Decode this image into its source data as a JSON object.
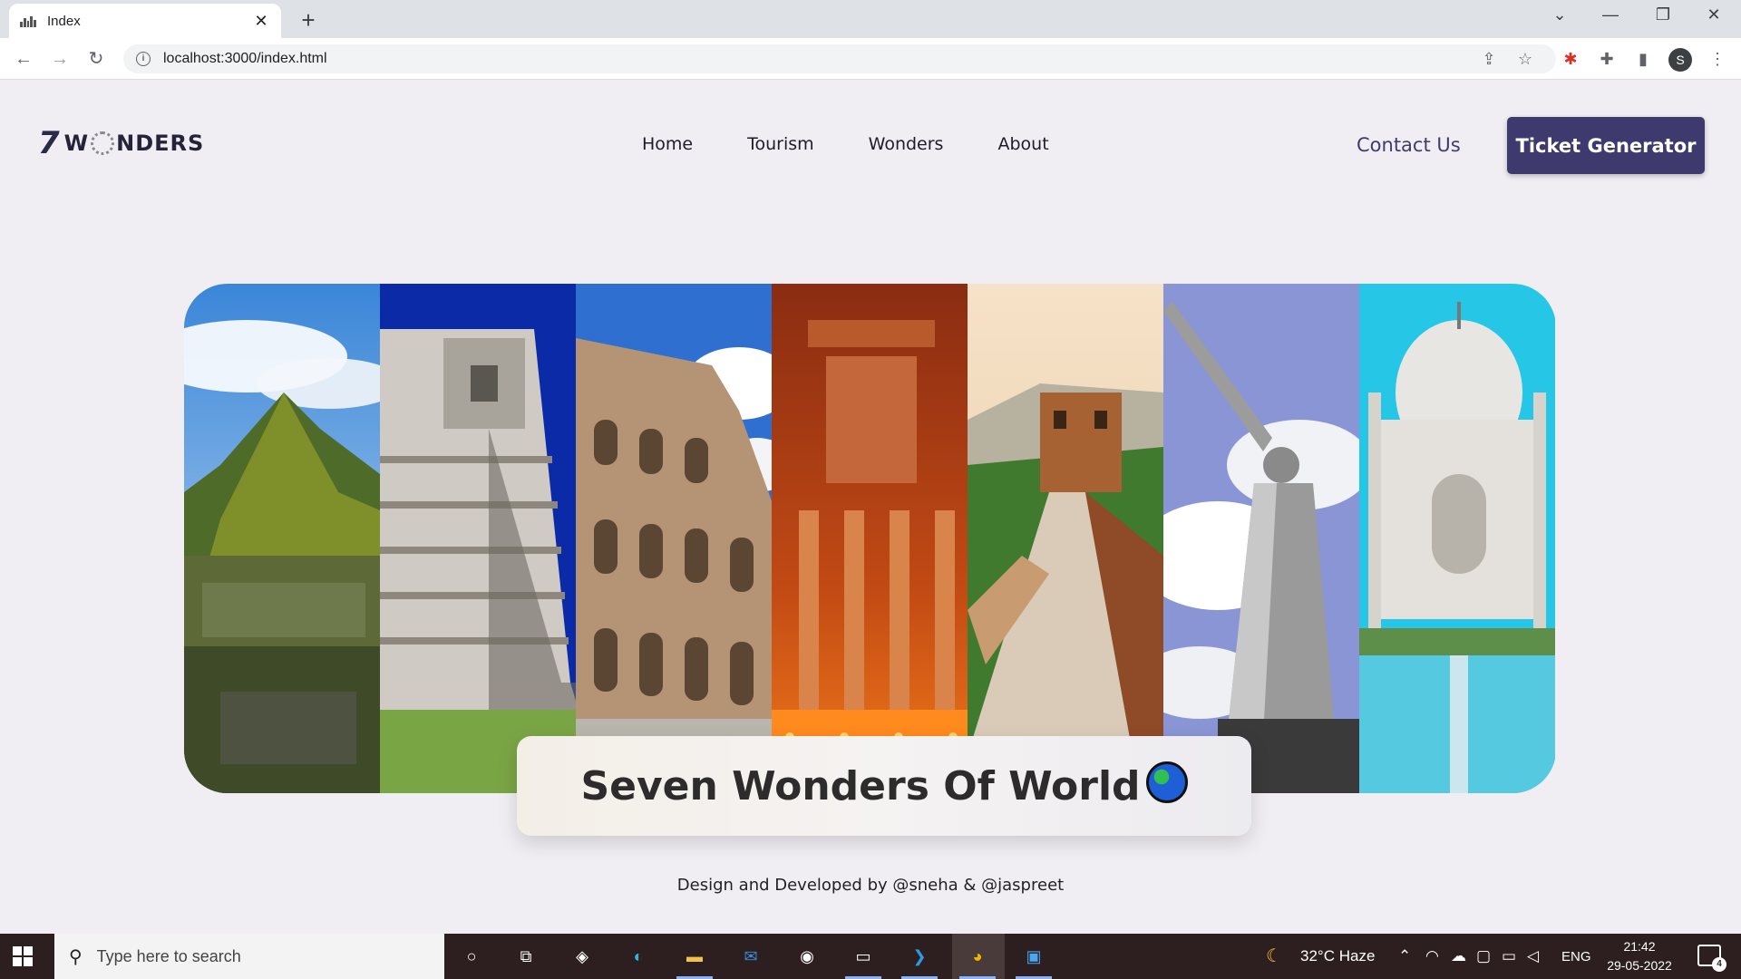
{
  "browser": {
    "tab_title": "Index",
    "tab_close": "✕",
    "new_tab": "+",
    "url": "localhost:3000/index.html",
    "window_controls": [
      "⌄",
      "—",
      "❐",
      "✕"
    ],
    "profile_initial": "S"
  },
  "site": {
    "logo_seven": "7",
    "logo_w": "W",
    "logo_rest": "NDERS",
    "nav": [
      "Home",
      "Tourism",
      "Wonders",
      "About"
    ],
    "contact_label": "Contact Us",
    "ticket_label": "Ticket Generator",
    "hero_title": "Seven Wonders Of World",
    "wonders": [
      "machu-picchu",
      "chichen-itza",
      "colosseum",
      "petra",
      "great-wall",
      "christ-the-redeemer",
      "taj-mahal"
    ],
    "footer": "Design and Developed by @sneha &  @jaspreet"
  },
  "taskbar": {
    "search_placeholder": "Type here to search",
    "weather": "32°C  Haze",
    "language": "ENG",
    "time": "21:42",
    "date": "29-05-2022",
    "notification_count": "4"
  }
}
